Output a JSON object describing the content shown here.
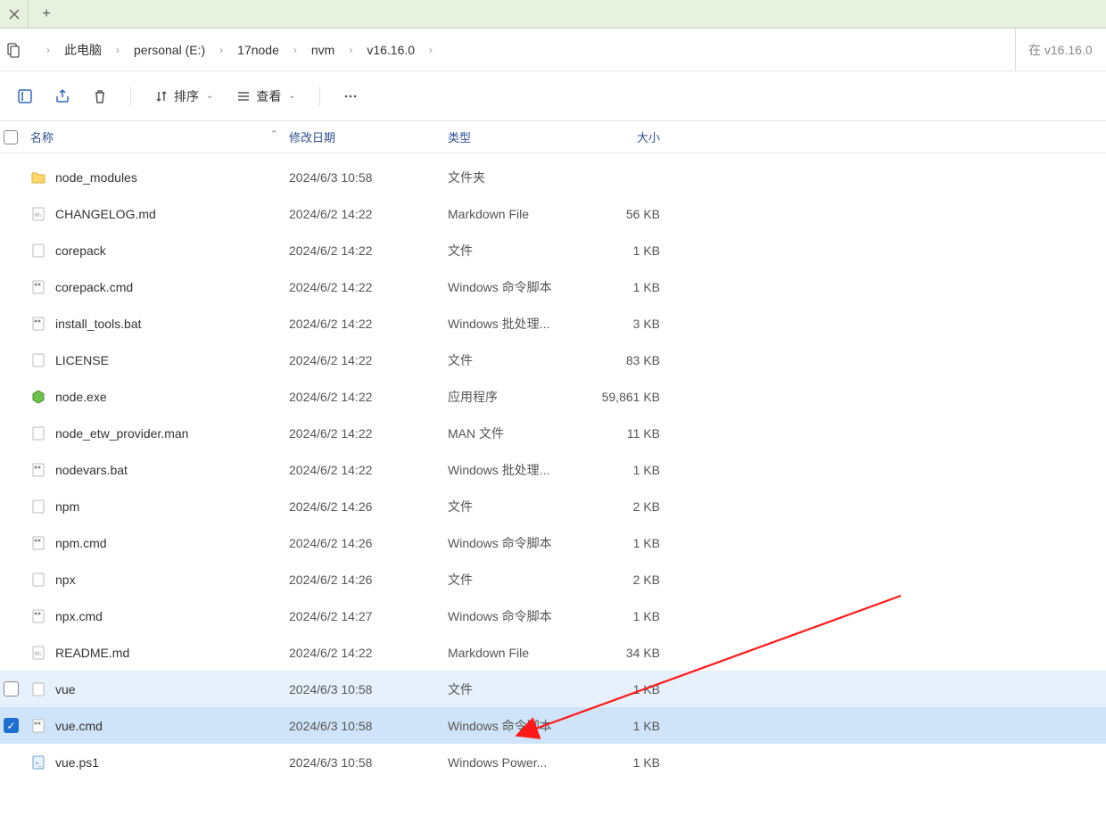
{
  "breadcrumb": {
    "items": [
      "此电脑",
      "personal (E:)",
      "17node",
      "nvm",
      "v16.16.0"
    ]
  },
  "search": {
    "placeholder": "在 v16.16.0"
  },
  "toolbar": {
    "sort_label": "排序",
    "view_label": "查看"
  },
  "columns": {
    "name": "名称",
    "date": "修改日期",
    "type": "类型",
    "size": "大小"
  },
  "files": [
    {
      "name": "node_modules",
      "date": "2024/6/3 10:58",
      "type": "文件夹",
      "size": "",
      "icon": "folder"
    },
    {
      "name": "CHANGELOG.md",
      "date": "2024/6/2 14:22",
      "type": "Markdown File",
      "size": "56 KB",
      "icon": "md"
    },
    {
      "name": "corepack",
      "date": "2024/6/2 14:22",
      "type": "文件",
      "size": "1 KB",
      "icon": "file"
    },
    {
      "name": "corepack.cmd",
      "date": "2024/6/2 14:22",
      "type": "Windows 命令脚本",
      "size": "1 KB",
      "icon": "cmd"
    },
    {
      "name": "install_tools.bat",
      "date": "2024/6/2 14:22",
      "type": "Windows 批处理...",
      "size": "3 KB",
      "icon": "cmd"
    },
    {
      "name": "LICENSE",
      "date": "2024/6/2 14:22",
      "type": "文件",
      "size": "83 KB",
      "icon": "file"
    },
    {
      "name": "node.exe",
      "date": "2024/6/2 14:22",
      "type": "应用程序",
      "size": "59,861 KB",
      "icon": "node"
    },
    {
      "name": "node_etw_provider.man",
      "date": "2024/6/2 14:22",
      "type": "MAN 文件",
      "size": "11 KB",
      "icon": "file"
    },
    {
      "name": "nodevars.bat",
      "date": "2024/6/2 14:22",
      "type": "Windows 批处理...",
      "size": "1 KB",
      "icon": "cmd"
    },
    {
      "name": "npm",
      "date": "2024/6/2 14:26",
      "type": "文件",
      "size": "2 KB",
      "icon": "file"
    },
    {
      "name": "npm.cmd",
      "date": "2024/6/2 14:26",
      "type": "Windows 命令脚本",
      "size": "1 KB",
      "icon": "cmd"
    },
    {
      "name": "npx",
      "date": "2024/6/2 14:26",
      "type": "文件",
      "size": "2 KB",
      "icon": "file"
    },
    {
      "name": "npx.cmd",
      "date": "2024/6/2 14:27",
      "type": "Windows 命令脚本",
      "size": "1 KB",
      "icon": "cmd"
    },
    {
      "name": "README.md",
      "date": "2024/6/2 14:22",
      "type": "Markdown File",
      "size": "34 KB",
      "icon": "md"
    },
    {
      "name": "vue",
      "date": "2024/6/3 10:58",
      "type": "文件",
      "size": "1 KB",
      "icon": "file",
      "state": "hover"
    },
    {
      "name": "vue.cmd",
      "date": "2024/6/3 10:58",
      "type": "Windows 命令脚本",
      "size": "1 KB",
      "icon": "cmd",
      "state": "selected",
      "checked": true
    },
    {
      "name": "vue.ps1",
      "date": "2024/6/3 10:58",
      "type": "Windows Power...",
      "size": "1 KB",
      "icon": "ps"
    }
  ]
}
